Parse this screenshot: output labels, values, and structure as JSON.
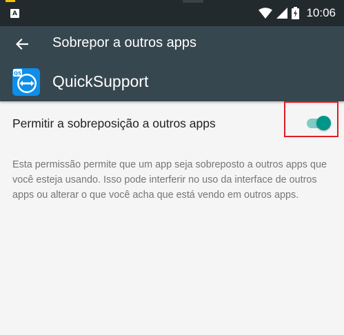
{
  "status_bar": {
    "notification_badge": "A",
    "time": "10:06",
    "icons": [
      "wifi-icon",
      "signal-icon",
      "battery-icon"
    ]
  },
  "app_bar": {
    "title": "Sobrepor a outros apps",
    "back_icon": "arrow-back-icon"
  },
  "app_header": {
    "app_name": "QuickSupport",
    "app_icon": "teamviewer-quicksupport-icon"
  },
  "setting": {
    "label": "Permitir a sobreposição a outros apps",
    "toggle_on": true
  },
  "description": "Esta permissão permite que um app seja sobreposto a outros apps que você esteja usando. Isso pode interferir no uso da interface de outros apps ou alterar o que você acha que está vendo em outros apps.",
  "colors": {
    "status_bar": "#222a2d",
    "app_bar": "#37474f",
    "toggle_thumb": "#009688",
    "toggle_track": "#80cbc4",
    "highlight": "#e01b24",
    "background": "#f5f5f5"
  }
}
